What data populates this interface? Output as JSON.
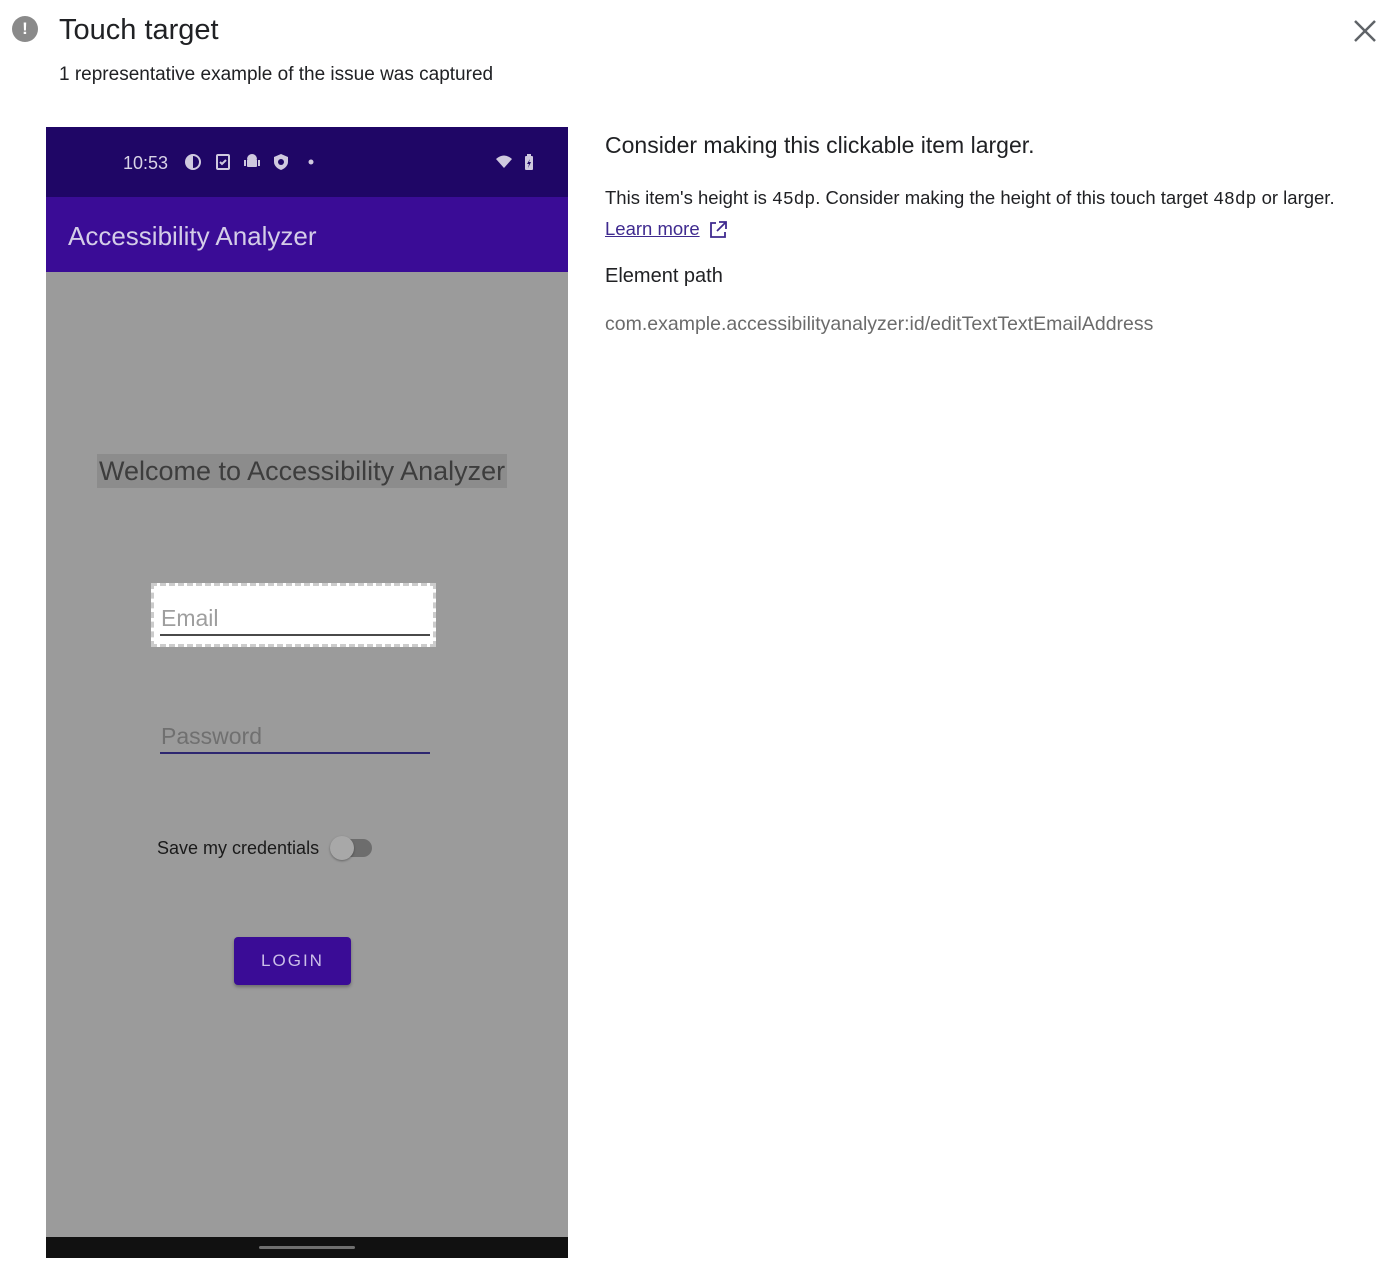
{
  "header": {
    "title": "Touch target",
    "subtitle": "1 representative example of the issue was captured",
    "warn_icon": "!"
  },
  "screenshot": {
    "status_bar": {
      "time": "10:53"
    },
    "app_bar": {
      "title": "Accessibility Analyzer"
    },
    "welcome_text": "Welcome to Accessibility Analyzer",
    "email_placeholder": "Email",
    "password_placeholder": "Password",
    "save_credentials_label": "Save my credentials",
    "login_button": "LOGIN",
    "colors": {
      "status_bar": "#1f0666",
      "app_bar": "#3a0c96",
      "overlay": "#9b9b9b"
    }
  },
  "details": {
    "heading": "Consider making this clickable item larger.",
    "desc_part1": "This item's height is ",
    "desc_value1": "45dp",
    "desc_part2": ". Consider making the height of this touch target ",
    "desc_value2": "48dp",
    "desc_part3": " or larger.",
    "learn_more": "Learn more",
    "element_path_label": "Element path",
    "element_path_value": "com.example.accessibilityanalyzer:id/editTextTextEmailAddress"
  }
}
